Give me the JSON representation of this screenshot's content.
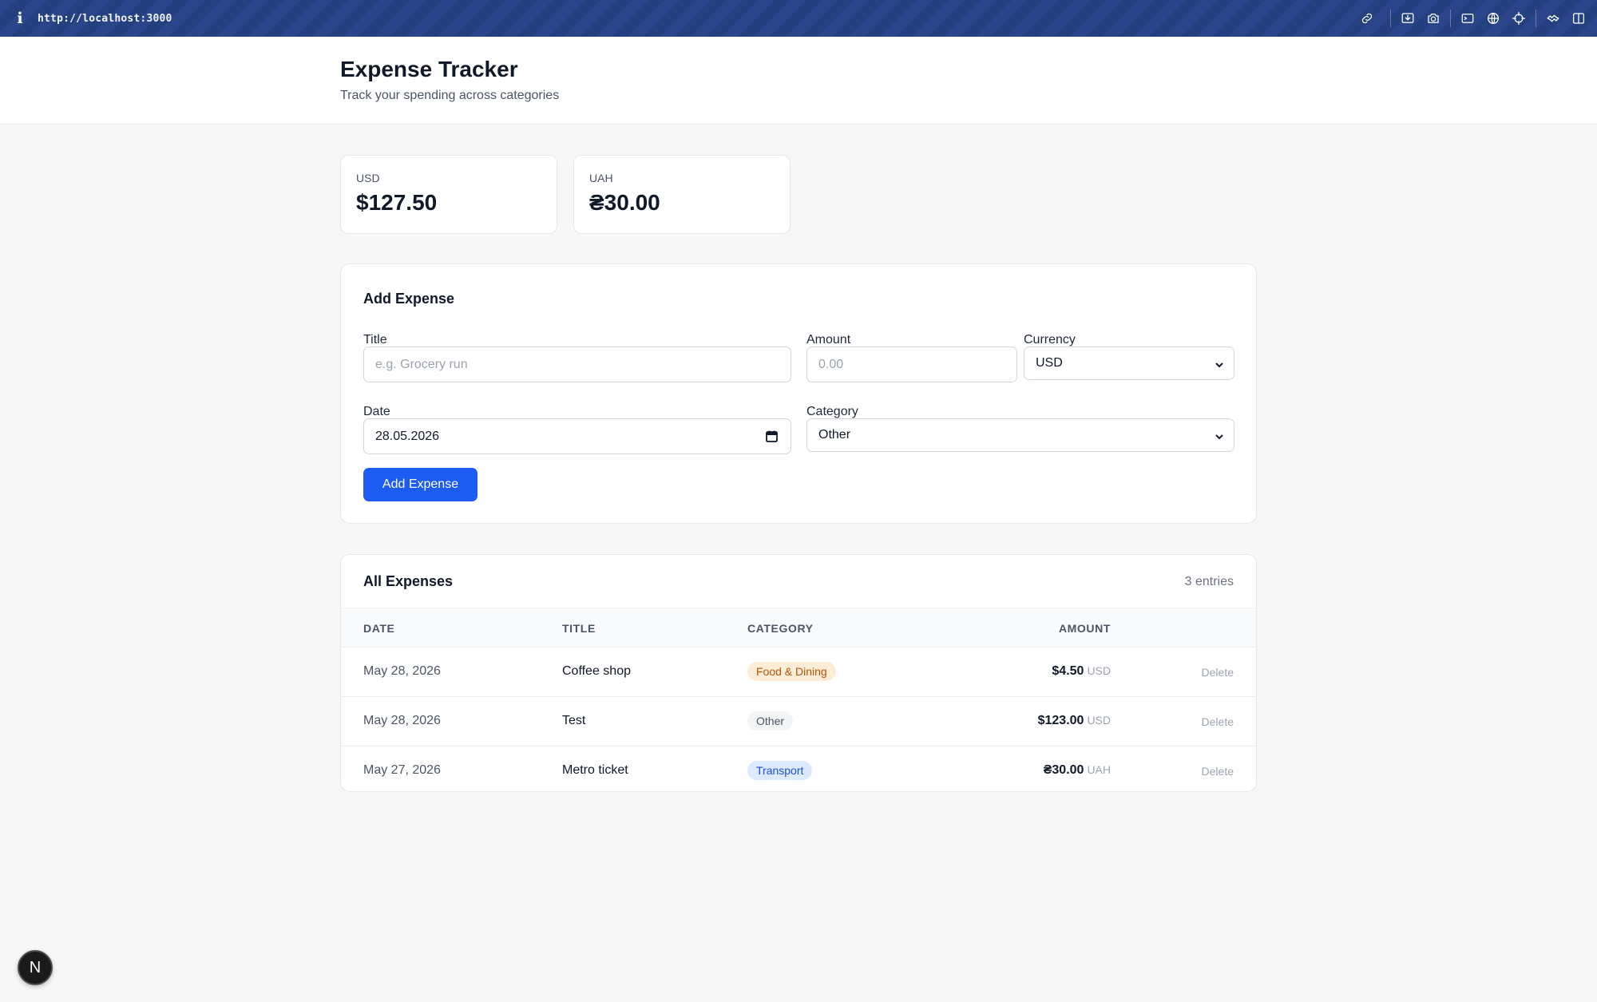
{
  "browser": {
    "info_glyph": "i",
    "url": "http://localhost:3000",
    "icons": [
      "link-icon",
      "download-icon",
      "camera-icon",
      "terminal-icon",
      "globe-icon",
      "crosshair-icon",
      "extension-icon",
      "sidebar-icon"
    ]
  },
  "header": {
    "title": "Expense Tracker",
    "subtitle": "Track your spending across categories"
  },
  "summary": [
    {
      "currency": "USD",
      "total": "$127.50"
    },
    {
      "currency": "UAH",
      "total": "₴30.00"
    }
  ],
  "form": {
    "heading": "Add Expense",
    "title_label": "Title",
    "title_placeholder": "e.g. Grocery run",
    "amount_label": "Amount",
    "amount_placeholder": "0.00",
    "currency_label": "Currency",
    "currency_value": "USD",
    "date_label": "Date",
    "date_value": "28.05.2026",
    "category_label": "Category",
    "category_value": "Other",
    "submit_label": "Add Expense"
  },
  "list": {
    "heading": "All Expenses",
    "count": "3 entries",
    "columns": {
      "date": "DATE",
      "title": "TITLE",
      "category": "CATEGORY",
      "amount": "AMOUNT"
    },
    "rows": [
      {
        "date": "May 28, 2026",
        "title": "Coffee shop",
        "category": "Food & Dining",
        "amount": "$4.50",
        "currency": "USD",
        "action": "Delete"
      },
      {
        "date": "May 28, 2026",
        "title": "Test",
        "category": "Other",
        "amount": "$123.00",
        "currency": "USD",
        "action": "Delete"
      },
      {
        "date": "May 27, 2026",
        "title": "Metro ticket",
        "category": "Transport",
        "amount": "₴30.00",
        "currency": "UAH",
        "action": "Delete"
      }
    ]
  },
  "badge_colors": {
    "food": {
      "bg": "#fdecd6",
      "fg": "#b45309"
    },
    "other": {
      "bg": "#f3f4f6",
      "fg": "#4b5563"
    },
    "transport": {
      "bg": "#dbeafe",
      "fg": "#1d4ed8"
    }
  },
  "accent": "#1d5cf0",
  "dev_badge": "N"
}
